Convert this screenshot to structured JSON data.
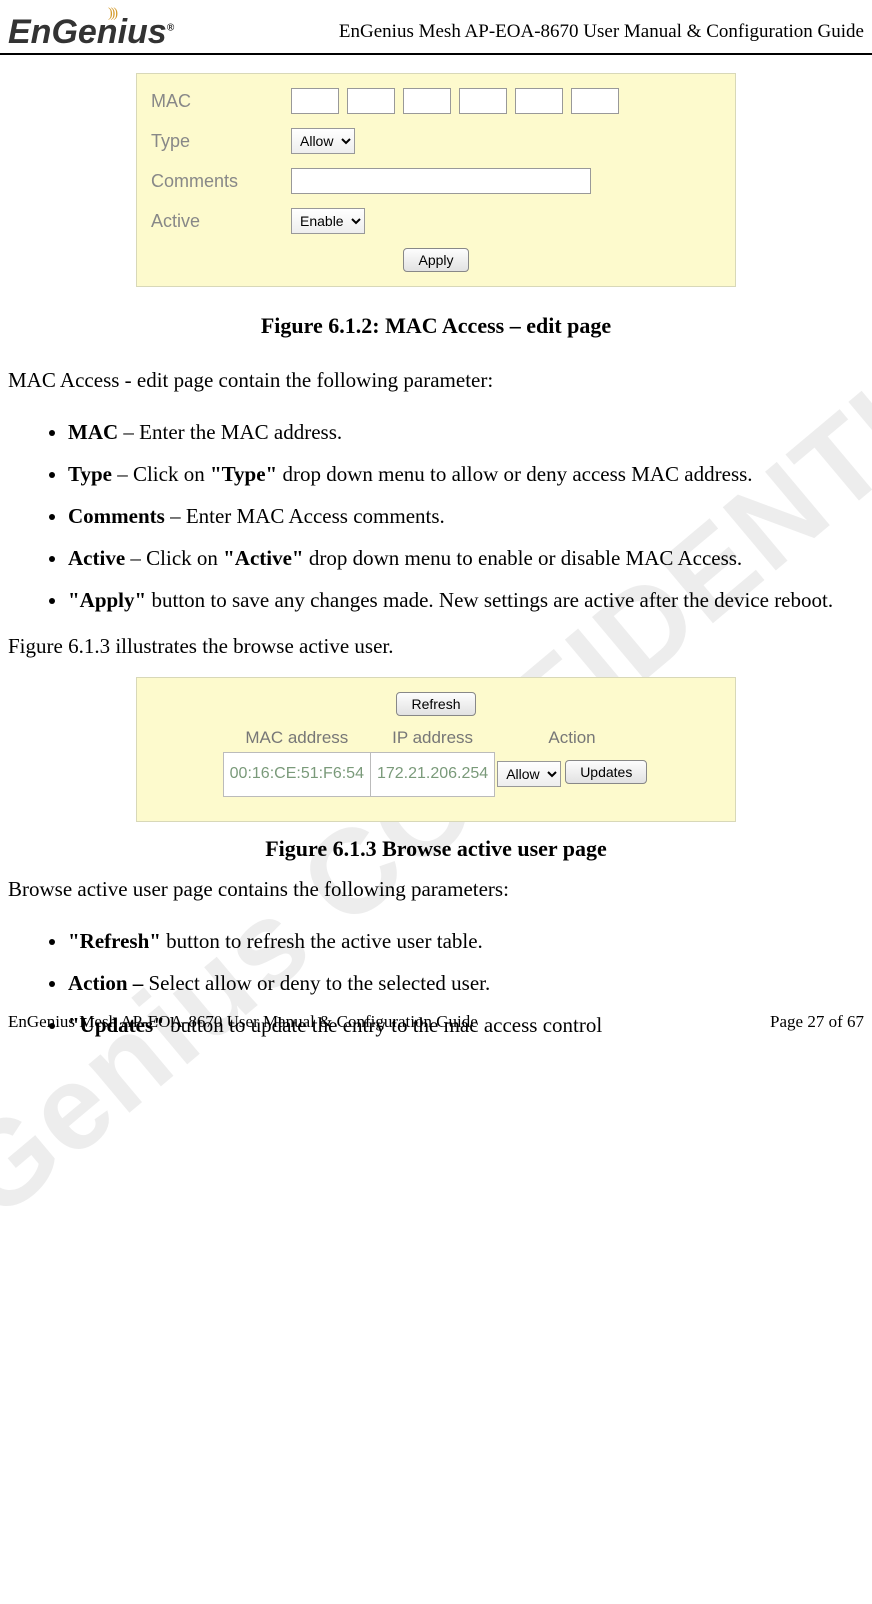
{
  "header": {
    "title": "EnGenius Mesh AP-EOA-8670 User Manual & Configuration Guide",
    "logo_text": "EnGenius",
    "logo_reg": "®"
  },
  "watermark": "EnGenius CONFIDENTIAL",
  "fig612": {
    "caption": "Figure 6.1.2: MAC Access – edit page",
    "labels": {
      "mac": "MAC",
      "type": "Type",
      "comments": "Comments",
      "active": "Active"
    },
    "type_value": "Allow",
    "active_value": "Enable",
    "apply_btn": "Apply"
  },
  "intro612": "MAC Access - edit page contain the following parameter:",
  "bullets612": [
    {
      "bold": "MAC",
      "rest": " – Enter the MAC address."
    },
    {
      "bold": "Type",
      "rest": " – Click on ",
      "bold2": "\"Type\"",
      "rest2": " drop down menu to allow or deny access MAC address."
    },
    {
      "bold": "Comments",
      "rest": " – Enter MAC Access comments."
    },
    {
      "bold": "Active",
      "rest": " – Click on ",
      "bold2": "\"Active\"",
      "rest2": " drop down menu to enable or disable MAC Access."
    },
    {
      "bold": "\"Apply\"",
      "rest": " button to save any changes made. New settings are active after the device reboot."
    }
  ],
  "intro613_pre": "Figure 6.1.3 illustrates the browse active user.",
  "fig613": {
    "caption": "Figure 6.1.3 Browse active user page",
    "refresh_btn": "Refresh",
    "headers": {
      "mac": "MAC address",
      "ip": "IP address",
      "action": "Action"
    },
    "row": {
      "mac": "00:16:CE:51:F6:54",
      "ip": "172.21.206.254",
      "action_value": "Allow",
      "updates_btn": "Updates"
    }
  },
  "intro613": "Browse active user page contains the following parameters:",
  "bullets613": [
    {
      "bold": "\"Refresh\"",
      "rest": " button to refresh the active user table."
    },
    {
      "bold": "Action –",
      "rest": " Select allow or deny to the selected user."
    },
    {
      "bold": "\"Updates\"",
      "rest": " button to update the entry to the mac access control"
    }
  ],
  "footer": {
    "left": "EnGenius Mesh AP-EOA-8670 User Manual & Configuration Guide",
    "right": "Page 27 of 67"
  }
}
